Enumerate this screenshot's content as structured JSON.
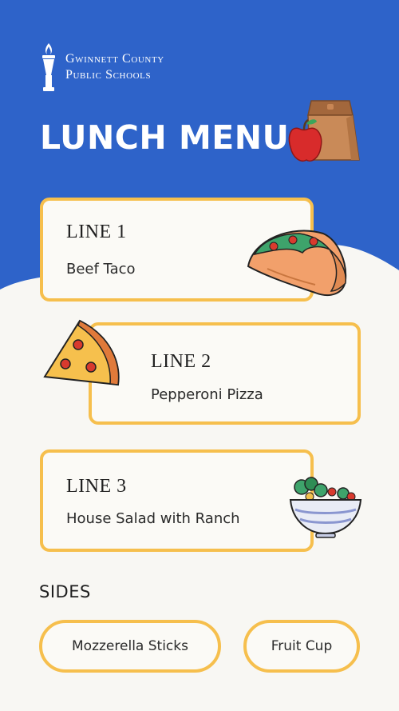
{
  "school": {
    "line1": "Gwinnett County",
    "line2": "Public Schools"
  },
  "title": "LUNCH MENU",
  "menu_lines": [
    {
      "label": "LINE 1",
      "dish": "Beef Taco",
      "icon": "taco-icon"
    },
    {
      "label": "LINE 2",
      "dish": "Pepperoni Pizza",
      "icon": "pizza-slice-icon"
    },
    {
      "label": "LINE 3",
      "dish": "House Salad with Ranch",
      "icon": "salad-bowl-icon"
    }
  ],
  "sides": {
    "heading": "SIDES",
    "items": [
      "Mozzerella Sticks",
      "Fruit Cup"
    ]
  },
  "colors": {
    "header_blue": "#2e63c9",
    "card_border": "#f6bf4d",
    "background": "#f8f7f3"
  },
  "decor": {
    "header_icon": "lunch-bag-apple-icon",
    "logo_icon": "torch-icon"
  }
}
